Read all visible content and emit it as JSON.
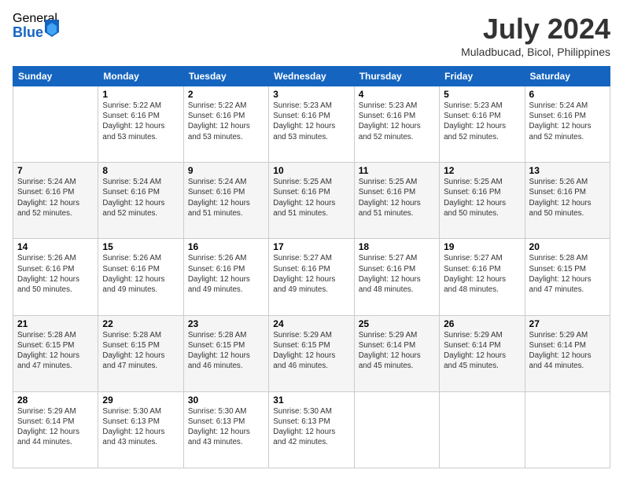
{
  "logo": {
    "general": "General",
    "blue": "Blue"
  },
  "title": "July 2024",
  "location": "Muladbucad, Bicol, Philippines",
  "weekdays": [
    "Sunday",
    "Monday",
    "Tuesday",
    "Wednesday",
    "Thursday",
    "Friday",
    "Saturday"
  ],
  "weeks": [
    [
      {
        "day": "",
        "info": ""
      },
      {
        "day": "1",
        "info": "Sunrise: 5:22 AM\nSunset: 6:16 PM\nDaylight: 12 hours\nand 53 minutes."
      },
      {
        "day": "2",
        "info": "Sunrise: 5:22 AM\nSunset: 6:16 PM\nDaylight: 12 hours\nand 53 minutes."
      },
      {
        "day": "3",
        "info": "Sunrise: 5:23 AM\nSunset: 6:16 PM\nDaylight: 12 hours\nand 53 minutes."
      },
      {
        "day": "4",
        "info": "Sunrise: 5:23 AM\nSunset: 6:16 PM\nDaylight: 12 hours\nand 52 minutes."
      },
      {
        "day": "5",
        "info": "Sunrise: 5:23 AM\nSunset: 6:16 PM\nDaylight: 12 hours\nand 52 minutes."
      },
      {
        "day": "6",
        "info": "Sunrise: 5:24 AM\nSunset: 6:16 PM\nDaylight: 12 hours\nand 52 minutes."
      }
    ],
    [
      {
        "day": "7",
        "info": "Sunrise: 5:24 AM\nSunset: 6:16 PM\nDaylight: 12 hours\nand 52 minutes."
      },
      {
        "day": "8",
        "info": "Sunrise: 5:24 AM\nSunset: 6:16 PM\nDaylight: 12 hours\nand 52 minutes."
      },
      {
        "day": "9",
        "info": "Sunrise: 5:24 AM\nSunset: 6:16 PM\nDaylight: 12 hours\nand 51 minutes."
      },
      {
        "day": "10",
        "info": "Sunrise: 5:25 AM\nSunset: 6:16 PM\nDaylight: 12 hours\nand 51 minutes."
      },
      {
        "day": "11",
        "info": "Sunrise: 5:25 AM\nSunset: 6:16 PM\nDaylight: 12 hours\nand 51 minutes."
      },
      {
        "day": "12",
        "info": "Sunrise: 5:25 AM\nSunset: 6:16 PM\nDaylight: 12 hours\nand 50 minutes."
      },
      {
        "day": "13",
        "info": "Sunrise: 5:26 AM\nSunset: 6:16 PM\nDaylight: 12 hours\nand 50 minutes."
      }
    ],
    [
      {
        "day": "14",
        "info": "Sunrise: 5:26 AM\nSunset: 6:16 PM\nDaylight: 12 hours\nand 50 minutes."
      },
      {
        "day": "15",
        "info": "Sunrise: 5:26 AM\nSunset: 6:16 PM\nDaylight: 12 hours\nand 49 minutes."
      },
      {
        "day": "16",
        "info": "Sunrise: 5:26 AM\nSunset: 6:16 PM\nDaylight: 12 hours\nand 49 minutes."
      },
      {
        "day": "17",
        "info": "Sunrise: 5:27 AM\nSunset: 6:16 PM\nDaylight: 12 hours\nand 49 minutes."
      },
      {
        "day": "18",
        "info": "Sunrise: 5:27 AM\nSunset: 6:16 PM\nDaylight: 12 hours\nand 48 minutes."
      },
      {
        "day": "19",
        "info": "Sunrise: 5:27 AM\nSunset: 6:16 PM\nDaylight: 12 hours\nand 48 minutes."
      },
      {
        "day": "20",
        "info": "Sunrise: 5:28 AM\nSunset: 6:15 PM\nDaylight: 12 hours\nand 47 minutes."
      }
    ],
    [
      {
        "day": "21",
        "info": "Sunrise: 5:28 AM\nSunset: 6:15 PM\nDaylight: 12 hours\nand 47 minutes."
      },
      {
        "day": "22",
        "info": "Sunrise: 5:28 AM\nSunset: 6:15 PM\nDaylight: 12 hours\nand 47 minutes."
      },
      {
        "day": "23",
        "info": "Sunrise: 5:28 AM\nSunset: 6:15 PM\nDaylight: 12 hours\nand 46 minutes."
      },
      {
        "day": "24",
        "info": "Sunrise: 5:29 AM\nSunset: 6:15 PM\nDaylight: 12 hours\nand 46 minutes."
      },
      {
        "day": "25",
        "info": "Sunrise: 5:29 AM\nSunset: 6:14 PM\nDaylight: 12 hours\nand 45 minutes."
      },
      {
        "day": "26",
        "info": "Sunrise: 5:29 AM\nSunset: 6:14 PM\nDaylight: 12 hours\nand 45 minutes."
      },
      {
        "day": "27",
        "info": "Sunrise: 5:29 AM\nSunset: 6:14 PM\nDaylight: 12 hours\nand 44 minutes."
      }
    ],
    [
      {
        "day": "28",
        "info": "Sunrise: 5:29 AM\nSunset: 6:14 PM\nDaylight: 12 hours\nand 44 minutes."
      },
      {
        "day": "29",
        "info": "Sunrise: 5:30 AM\nSunset: 6:13 PM\nDaylight: 12 hours\nand 43 minutes."
      },
      {
        "day": "30",
        "info": "Sunrise: 5:30 AM\nSunset: 6:13 PM\nDaylight: 12 hours\nand 43 minutes."
      },
      {
        "day": "31",
        "info": "Sunrise: 5:30 AM\nSunset: 6:13 PM\nDaylight: 12 hours\nand 42 minutes."
      },
      {
        "day": "",
        "info": ""
      },
      {
        "day": "",
        "info": ""
      },
      {
        "day": "",
        "info": ""
      }
    ]
  ]
}
